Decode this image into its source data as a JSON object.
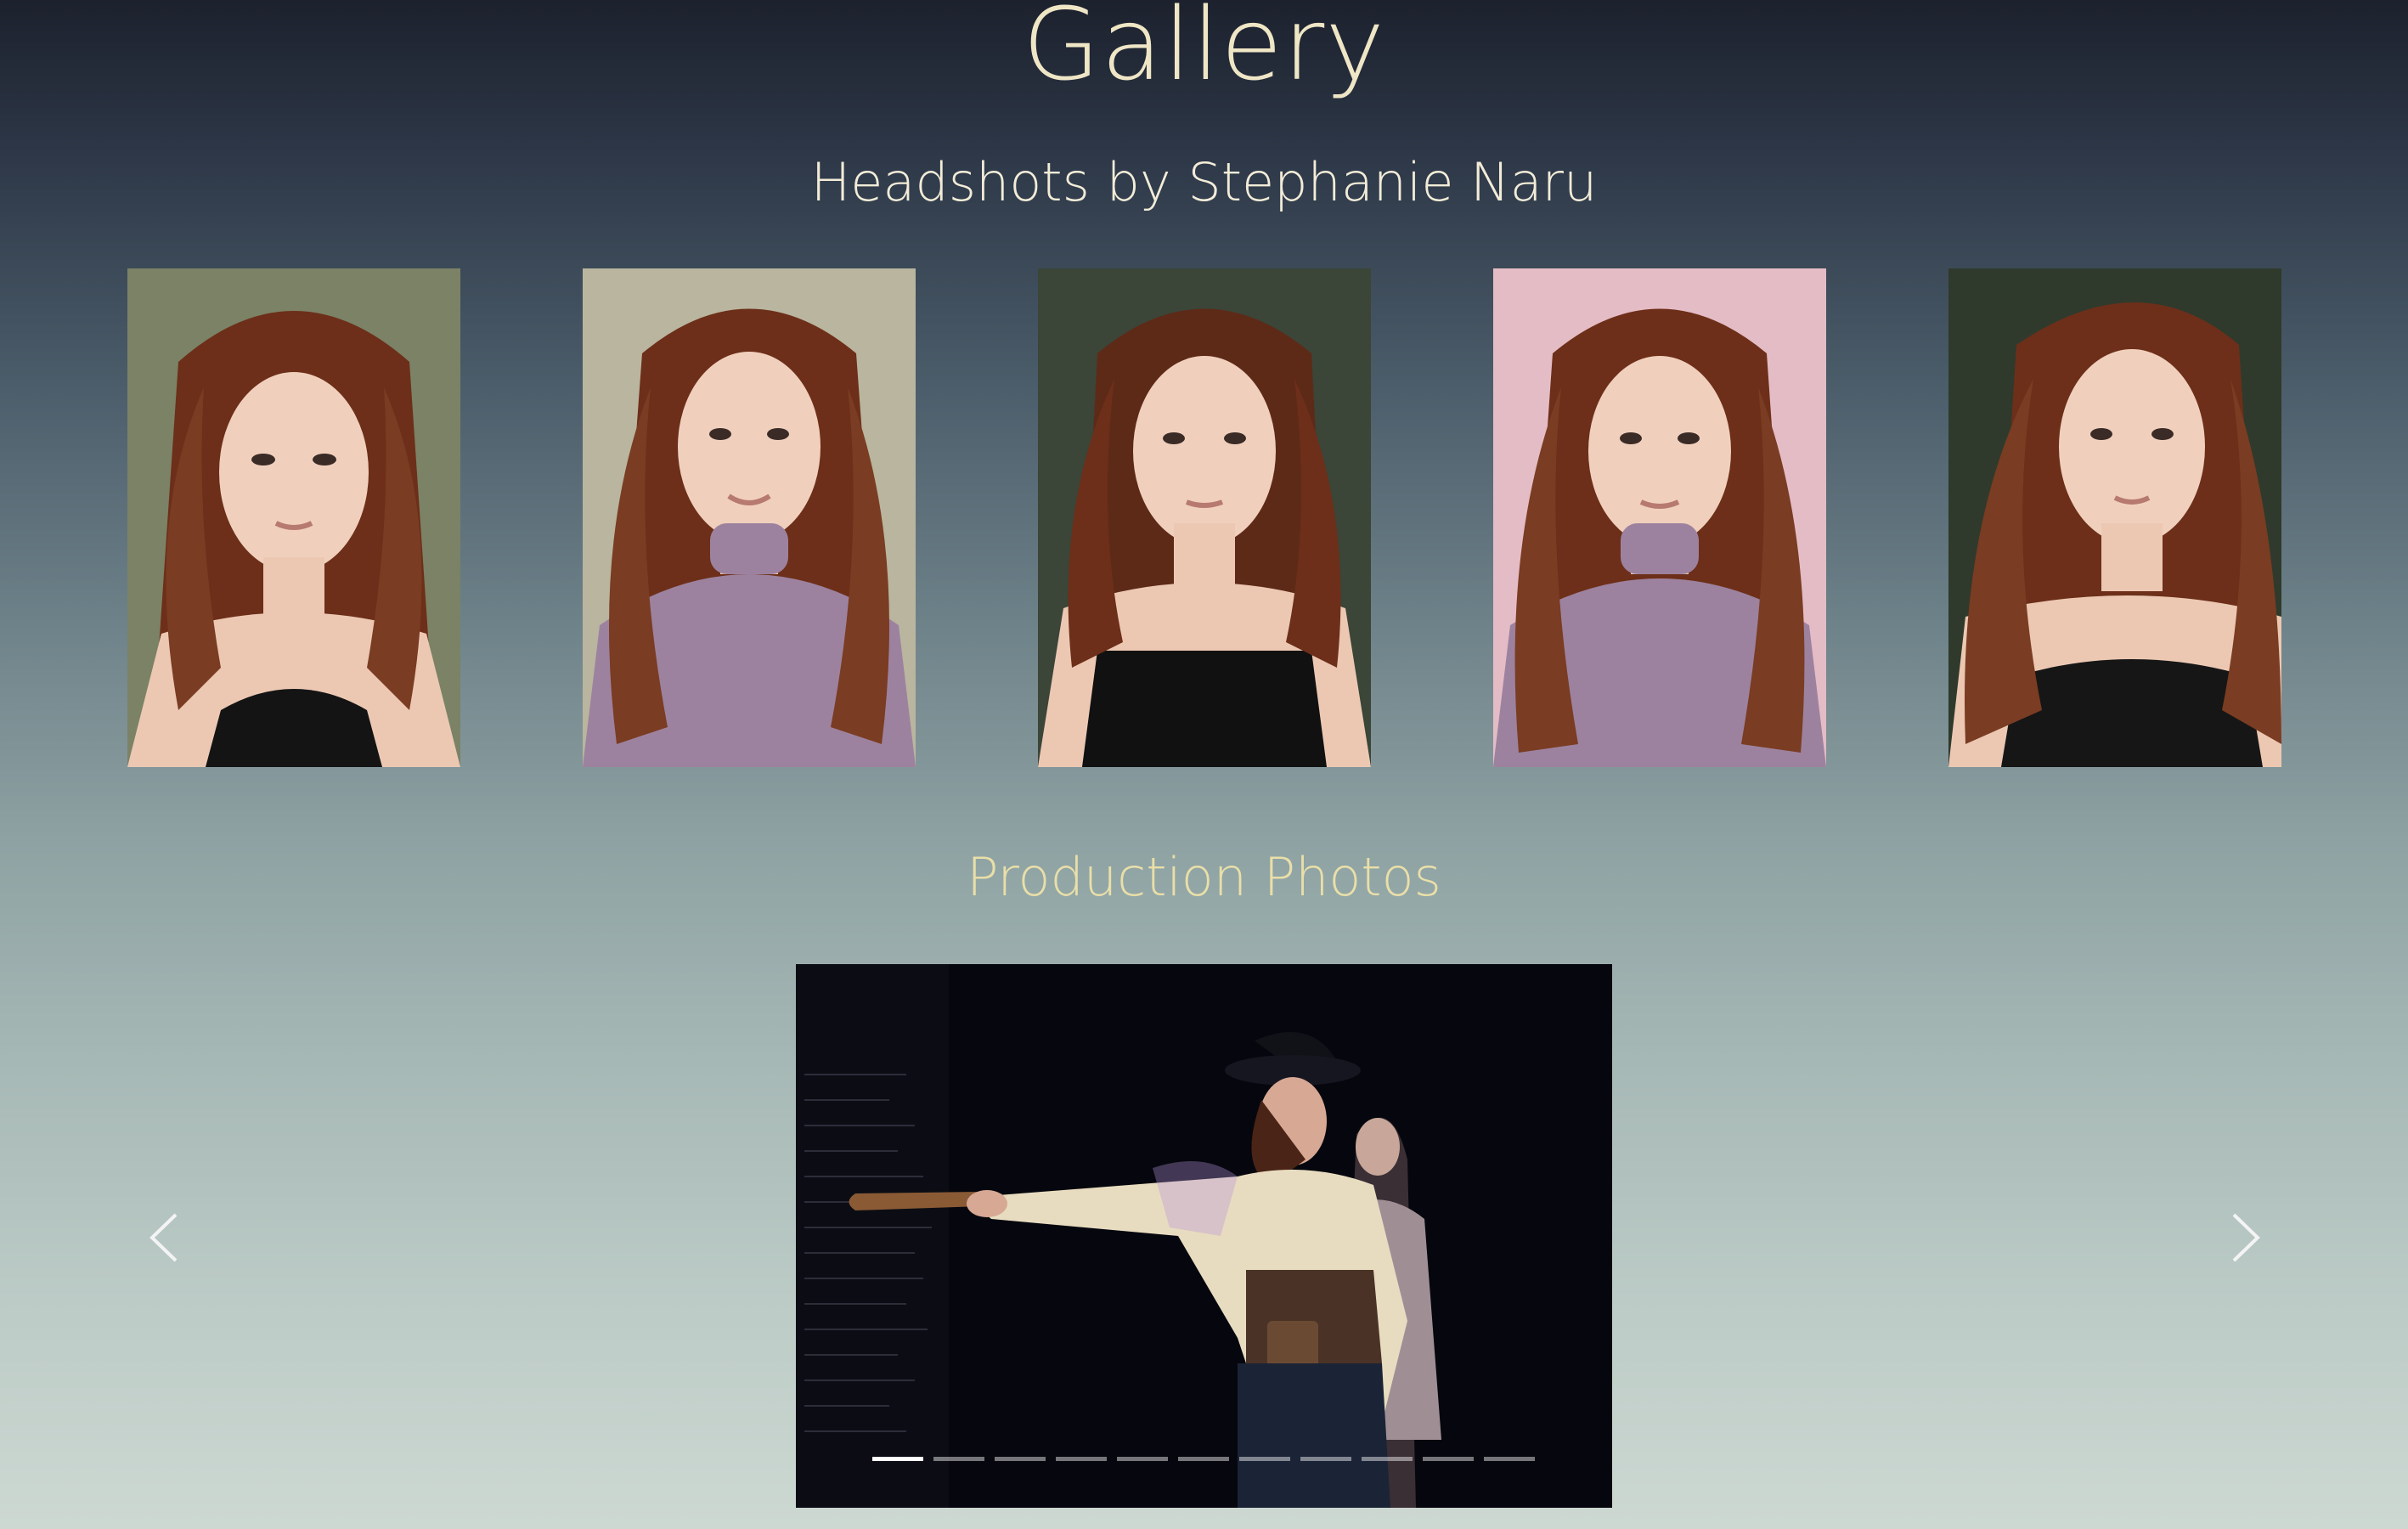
{
  "page": {
    "title": "Gallery"
  },
  "headshots": {
    "title": "Headshots by Stephanie Naru",
    "items": [
      {
        "bg": "#7b8266",
        "top": "#3c2a1f",
        "alt_icon": "headshot-photo"
      },
      {
        "bg": "#b9b59f",
        "top": "#8e7c9c",
        "alt_icon": "headshot-photo"
      },
      {
        "bg": "#3b4538",
        "top": "#111111",
        "alt_icon": "headshot-photo"
      },
      {
        "bg": "#e4bcc5",
        "top": "#9d829f",
        "alt_icon": "headshot-photo"
      },
      {
        "bg": "#2f3a2c",
        "top": "#161616",
        "alt_icon": "headshot-photo"
      }
    ]
  },
  "production": {
    "title": "Production Photos",
    "slide_count": 11,
    "active_slide": 0
  },
  "colors": {
    "title": "#efe6c6",
    "subtitle": "#f2ecd8",
    "accent": "#e9dfa8",
    "hair": "#7a3c22",
    "skin": "#f0d0bd"
  }
}
